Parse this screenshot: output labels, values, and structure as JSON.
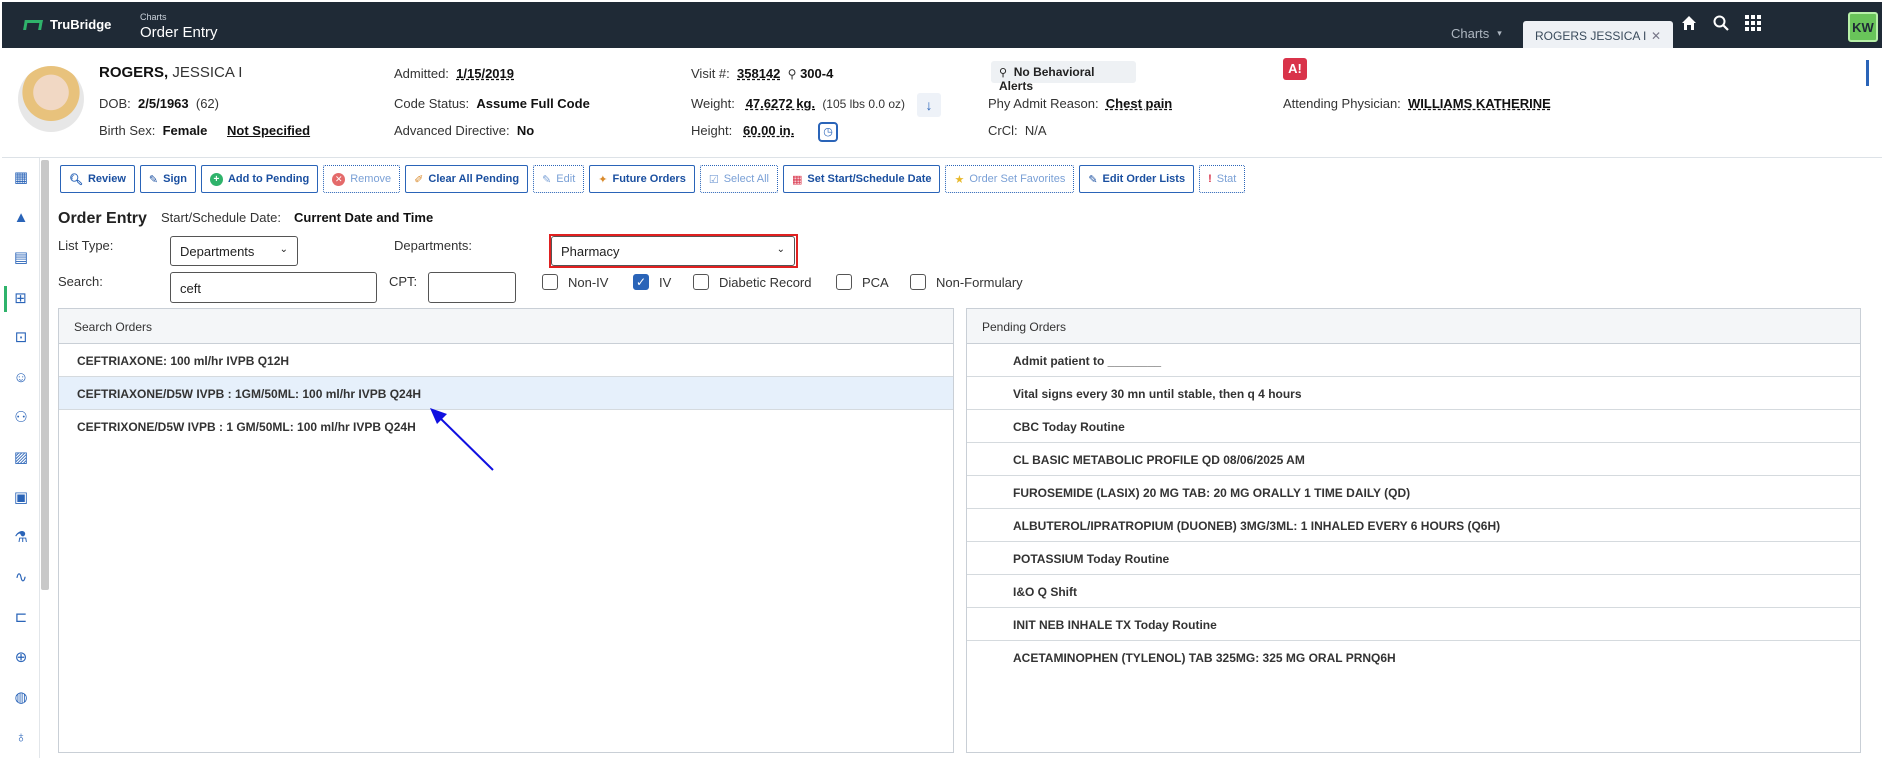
{
  "app": {
    "brand": "TruBridge",
    "crumb_small": "Charts",
    "crumb_big": "Order Entry",
    "tab_charts": "Charts",
    "tab_active": "ROGERS JESSICA I",
    "user_initials": "KW"
  },
  "patient": {
    "last_name": "ROGERS,",
    "first_name": "JESSICA I",
    "dob_label": "DOB:",
    "dob": "2/5/1963",
    "age": "(62)",
    "birth_sex_label": "Birth Sex:",
    "birth_sex": "Female",
    "gender": "Not Specified",
    "admitted_label": "Admitted:",
    "admitted": "1/15/2019",
    "code_status_label": "Code Status:",
    "code_status": "Assume Full Code",
    "adv_dir_label": "Advanced Directive:",
    "adv_dir": "No",
    "visit_label": "Visit #:",
    "visit": "358142",
    "room": "300-4",
    "weight_label": "Weight:",
    "weight": "47.6272 kg.",
    "weight_lbs": "(105 lbs 0.0 oz)",
    "height_label": "Height:",
    "height": "60.00 in.",
    "behavioral": "No Behavioral Alerts",
    "phy_reason_label": "Phy Admit Reason:",
    "phy_reason": "Chest pain",
    "crcl_label": "CrCl:",
    "crcl": "N/A",
    "attending_label": "Attending Physician:",
    "attending": "WILLIAMS KATHERINE"
  },
  "toolbar": {
    "review": "Review",
    "sign": "Sign",
    "add_pending": "Add to Pending",
    "remove": "Remove",
    "clear_pending": "Clear All Pending",
    "edit": "Edit",
    "future_orders": "Future Orders",
    "select_all": "Select All",
    "set_start": "Set Start/Schedule Date",
    "order_set_fav": "Order Set Favorites",
    "edit_order_lists": "Edit Order Lists",
    "stat": "Stat"
  },
  "form": {
    "title": "Order Entry",
    "start_label": "Start/Schedule Date:",
    "start_value": "Current Date and Time",
    "list_type_label": "List Type:",
    "list_type": "Departments",
    "departments_label": "Departments:",
    "department": "Pharmacy",
    "search_label": "Search:",
    "search_value": "ceft",
    "cpt_label": "CPT:",
    "cpt_value": "",
    "checks": {
      "non_iv": "Non-IV",
      "iv": "IV",
      "diabetic": "Diabetic Record",
      "pca": "PCA",
      "non_formulary": "Non-Formulary"
    }
  },
  "search_orders": {
    "header": "Search Orders",
    "rows": [
      "CEFTRIAXONE: 100 ml/hr IVPB Q12H",
      "CEFTRIAXONE/D5W IVPB : 1GM/50ML: 100 ml/hr IVPB Q24H",
      "CEFTRIXONE/D5W IVPB : 1 GM/50ML: 100 ml/hr IVPB Q24H"
    ]
  },
  "pending_orders": {
    "header": "Pending Orders",
    "rows": [
      "Admit patient to ________",
      "Vital signs every 30 mn until stable, then q 4 hours",
      "CBC Today Routine",
      "CL BASIC METABOLIC PROFILE QD 08/06/2025 AM",
      "FUROSEMIDE (LASIX) 20 MG TAB: 20 MG ORALLY 1 TIME DAILY (QD)",
      "ALBUTEROL/IPRATROPIUM (DUONEB) 3MG/3ML: 1 INHALED EVERY 6 HOURS (Q6H)",
      "POTASSIUM Today Routine",
      "I&O Q Shift",
      "INIT NEB INHALE TX Today Routine",
      "ACETAMINOPHEN (TYLENOL) TAB 325MG: 325 MG ORAL PRNQ6H"
    ]
  },
  "colors": {
    "topbar": "#1f2a36",
    "accent": "#2a64b8",
    "brand_green": "#2fb36b",
    "alert_red": "#d9334a",
    "highlight_row": "#e6f0fb",
    "arrow": "#1010e0"
  }
}
